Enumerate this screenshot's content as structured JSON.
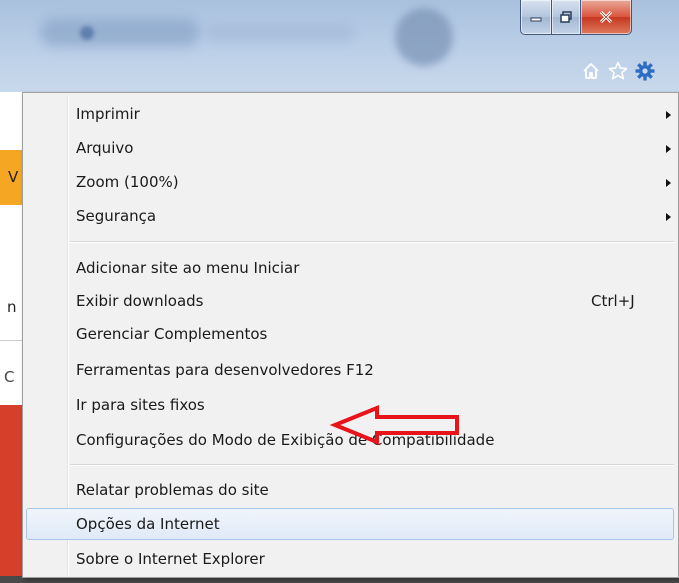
{
  "window": {
    "minimize_icon": "minimize-icon",
    "maximize_icon": "maximize-icon",
    "close_icon": "close-icon"
  },
  "toolbar": {
    "icons": [
      "home-icon",
      "star-icon",
      "gear-icon"
    ]
  },
  "background_fragments": {
    "left_v": "V",
    "left_n": "n",
    "left_c": "C"
  },
  "menu": {
    "items": [
      {
        "label": "Imprimir",
        "submenu": true
      },
      {
        "label": "Arquivo",
        "submenu": true
      },
      {
        "label": "Zoom (100%)",
        "submenu": true
      },
      {
        "label": "Segurança",
        "submenu": true
      },
      {
        "label": "Adicionar site ao menu Iniciar"
      },
      {
        "label": "Exibir downloads",
        "shortcut": "Ctrl+J"
      },
      {
        "label": "Gerenciar Complementos"
      },
      {
        "label": "Ferramentas para desenvolvedores F12"
      },
      {
        "label": "Ir para sites fixos"
      },
      {
        "label": "Configurações do Modo de Exibição de Compatibilidade"
      },
      {
        "label": "Relatar problemas do site"
      },
      {
        "label": "Opções da Internet",
        "highlighted": true
      },
      {
        "label": "Sobre o Internet Explorer"
      }
    ]
  },
  "colors": {
    "annotation_arrow": "#e8141a",
    "menu_background": "#f1f1f1",
    "highlight_border": "#a8c6ea"
  }
}
